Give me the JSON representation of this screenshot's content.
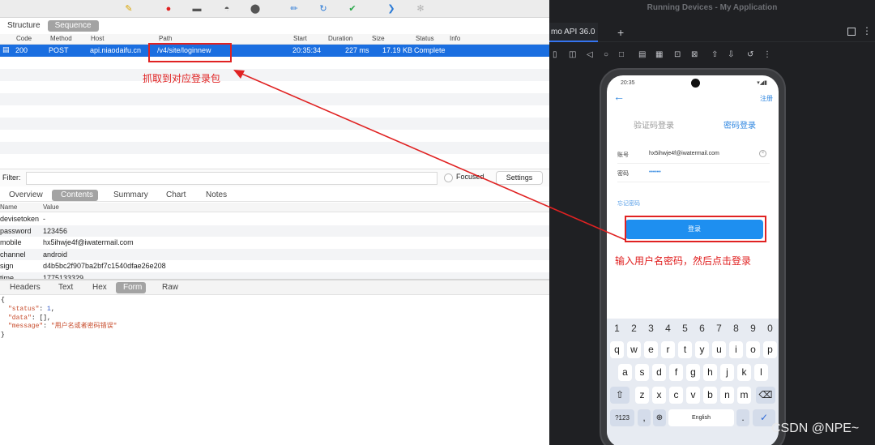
{
  "charles": {
    "view_tabs": [
      "Structure",
      "Sequence"
    ],
    "active_view_tab": "Sequence",
    "columns": [
      "Code",
      "Method",
      "Host",
      "Path",
      "Start",
      "Duration",
      "Size",
      "Status",
      "Info"
    ],
    "selected_request": {
      "code": "200",
      "method": "POST",
      "host": "api.niaodaifu.cn",
      "path": "/v4/site/loginnew",
      "start": "20:35:34",
      "duration": "227 ms",
      "size": "17.19 KB",
      "status": "Complete"
    },
    "filter": {
      "label": "Filter:",
      "value": "",
      "focused_label": "Focused",
      "settings_label": "Settings"
    },
    "request_tabs": [
      "Overview",
      "Contents",
      "Summary",
      "Chart",
      "Notes"
    ],
    "active_request_tab": "Contents",
    "kv_columns": [
      "Name",
      "Value"
    ],
    "params": [
      {
        "name": "devisetoken",
        "value": "-"
      },
      {
        "name": "password",
        "value": "123456"
      },
      {
        "name": "mobile",
        "value": "hx5ihwje4f@iwatermail.com"
      },
      {
        "name": "channel",
        "value": "android"
      },
      {
        "name": "sign",
        "value": "d4b5bc2f907ba2bf7c1540dfae26e208"
      },
      {
        "name": "time",
        "value": "1775133329"
      }
    ],
    "response_tabs": [
      "Headers",
      "Text",
      "Hex",
      "Form",
      "Raw"
    ],
    "active_response_tab": "Form",
    "response_json": {
      "open": "{",
      "status_key": "\"status\"",
      "status_val": "1",
      "data_key": "\"data\"",
      "data_val": "[]",
      "message_key": "\"message\"",
      "message_val": "\"用户名或者密码错误\"",
      "close": "}"
    }
  },
  "annotations": {
    "left_note": "抓取到对应登录包",
    "right_note": "输入用户名密码，然后点击登录",
    "accent": "#e02222"
  },
  "devices": {
    "window_title": "Running Devices - My Application",
    "tab_label": "mo API 36.0",
    "add_tab": "+",
    "phone": {
      "time": "20:35",
      "register": "注册",
      "tab_code": "验证码登录",
      "tab_password": "密码登录",
      "account_label": "账号",
      "account_value": "hx5ihwje4f@iwatermail.com",
      "password_label": "密码",
      "password_value": "••••••",
      "forgot": "忘记密码",
      "login_button": "登录",
      "keyboard": {
        "numbers": [
          "1",
          "2",
          "3",
          "4",
          "5",
          "6",
          "7",
          "8",
          "9",
          "0"
        ],
        "row1": [
          "q",
          "w",
          "e",
          "r",
          "t",
          "y",
          "u",
          "i",
          "o",
          "p"
        ],
        "row2": [
          "a",
          "s",
          "d",
          "f",
          "g",
          "h",
          "j",
          "k",
          "l"
        ],
        "row3": [
          "z",
          "x",
          "c",
          "v",
          "b",
          "n",
          "m"
        ],
        "sym": "?123",
        "comma": ",",
        "space": "English",
        "period": "."
      }
    }
  },
  "watermark": "CSDN @NPE~"
}
